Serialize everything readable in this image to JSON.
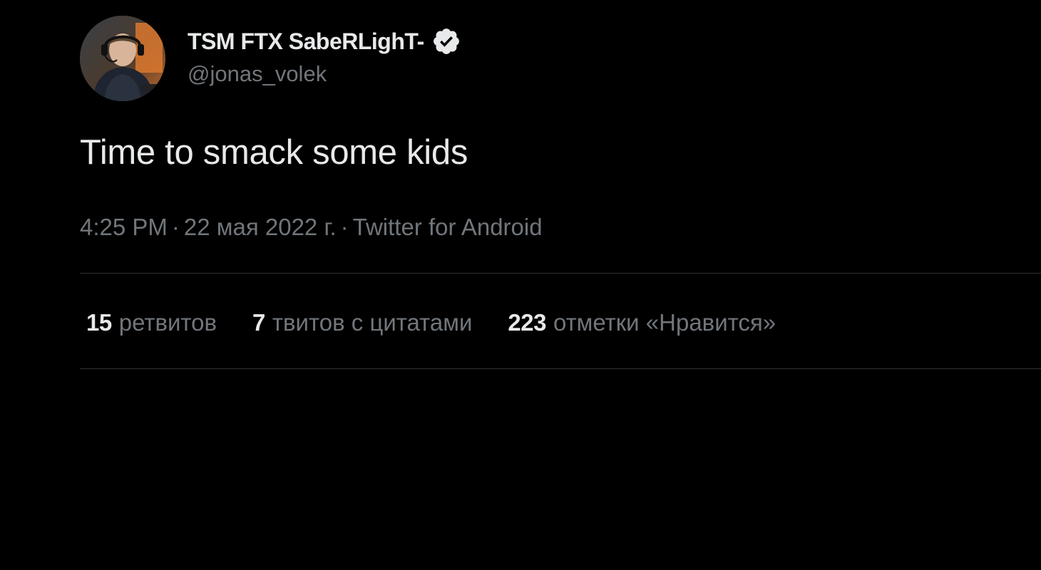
{
  "author": {
    "display_name": "TSM FTX SabeRLighT-",
    "handle": "@jonas_volek",
    "verified": true,
    "avatar_icon": "profile-photo"
  },
  "tweet": {
    "text": "Time to smack some kids"
  },
  "meta": {
    "time": "4:25 PM",
    "separator": "·",
    "date": "22 мая 2022 г.",
    "source": "Twitter for Android"
  },
  "stats": {
    "retweets": {
      "count": "15",
      "label": "ретвитов"
    },
    "quotes": {
      "count": "7",
      "label": "твитов с цитатами"
    },
    "likes": {
      "count": "223",
      "label": "отметки «Нравится»"
    }
  },
  "colors": {
    "background": "#000000",
    "primary_text": "#e7e9ea",
    "secondary_text": "#71767b",
    "divider": "#2f3336"
  }
}
